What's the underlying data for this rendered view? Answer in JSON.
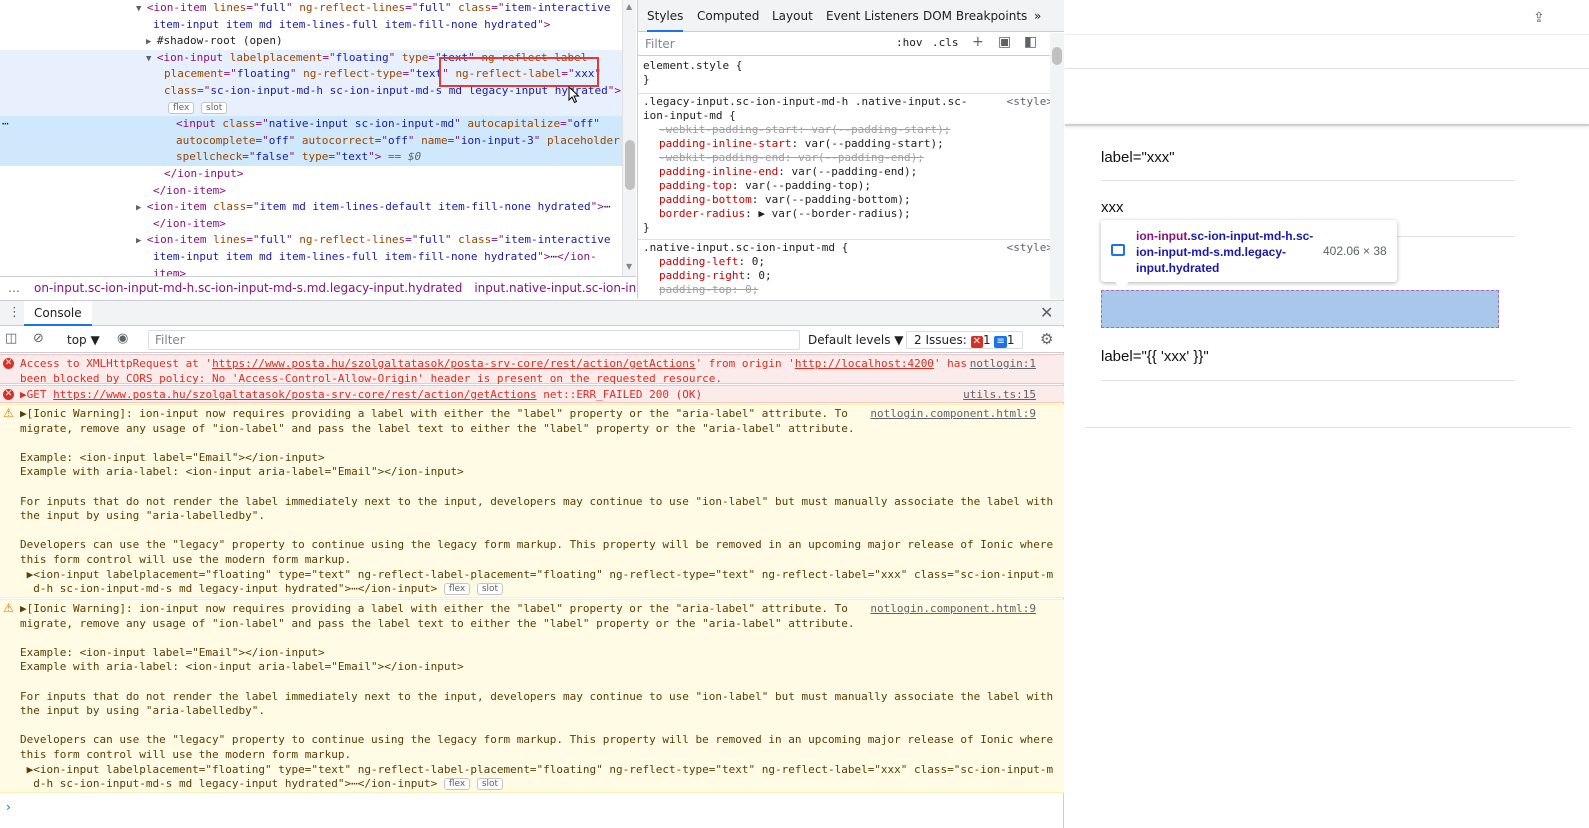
{
  "elements": {
    "lines": [
      {
        "indent": 146,
        "tri": "▼",
        "html": [
          [
            "tag",
            "<ion-item "
          ],
          [
            "attr",
            "lines"
          ],
          [
            "tag",
            "=\""
          ],
          [
            "val",
            "full"
          ],
          [
            "tag",
            "\" "
          ],
          [
            "attr",
            "ng-reflect-lines"
          ],
          [
            "tag",
            "=\""
          ],
          [
            "val",
            "full"
          ],
          [
            "tag",
            "\" "
          ],
          [
            "attr",
            "class"
          ],
          [
            "tag",
            "=\""
          ],
          [
            "val",
            "item-interactive"
          ]
        ]
      },
      {
        "indent": 153,
        "html": [
          [
            "val",
            "item-input item md item-lines-full item-fill-none hydrated"
          ],
          [
            "tag",
            "\">"
          ]
        ]
      },
      {
        "indent": 156,
        "tri": "▶",
        "html": [
          [
            "plain",
            "#shadow-root (open)"
          ]
        ]
      },
      {
        "indent": 156,
        "tri": "▼",
        "html": [
          [
            "tag",
            "<ion-input "
          ],
          [
            "attr",
            "labelplacement"
          ],
          [
            "tag",
            "=\""
          ],
          [
            "val",
            "floating"
          ],
          [
            "tag",
            "\" "
          ],
          [
            "attr",
            "type"
          ],
          [
            "tag",
            "=\""
          ],
          [
            "val",
            "text"
          ],
          [
            "tag",
            "\" "
          ],
          [
            "attr",
            "ng-reflect-label-"
          ]
        ],
        "hl": true
      },
      {
        "indent": 164,
        "html": [
          [
            "attr",
            "placement"
          ],
          [
            "tag",
            "=\""
          ],
          [
            "val",
            "floating"
          ],
          [
            "tag",
            "\" "
          ],
          [
            "attr",
            "ng-reflect-type"
          ],
          [
            "tag",
            "=\""
          ],
          [
            "val",
            "text"
          ],
          [
            "tag",
            "\" "
          ],
          [
            "attr",
            "ng-reflect-label"
          ],
          [
            "tag",
            "=\""
          ],
          [
            "val",
            "xxx"
          ],
          [
            "tag",
            "\""
          ]
        ],
        "hl": true
      },
      {
        "indent": 164,
        "html": [
          [
            "attr",
            "class"
          ],
          [
            "tag",
            "=\""
          ],
          [
            "val",
            "sc-ion-input-md-h sc-ion-input-md-s md legacy-input hydrated"
          ],
          [
            "tag",
            "\">"
          ]
        ],
        "hl": true
      },
      {
        "indent": 168,
        "badges": [
          "flex",
          "slot"
        ],
        "hl": true
      },
      {
        "indent": 176,
        "html": [
          [
            "tag",
            "<input "
          ],
          [
            "attr",
            "class"
          ],
          [
            "tag",
            "=\""
          ],
          [
            "val",
            "native-input sc-ion-input-md"
          ],
          [
            "tag",
            "\" "
          ],
          [
            "attr",
            "autocapitalize"
          ],
          [
            "tag",
            "=\""
          ],
          [
            "val",
            "off"
          ],
          [
            "tag",
            "\""
          ]
        ],
        "sel": true
      },
      {
        "indent": 176,
        "html": [
          [
            "attr",
            "autocomplete"
          ],
          [
            "tag",
            "=\""
          ],
          [
            "val",
            "off"
          ],
          [
            "tag",
            "\" "
          ],
          [
            "attr",
            "autocorrect"
          ],
          [
            "tag",
            "=\""
          ],
          [
            "val",
            "off"
          ],
          [
            "tag",
            "\" "
          ],
          [
            "attr",
            "name"
          ],
          [
            "tag",
            "=\""
          ],
          [
            "val",
            "ion-input-3"
          ],
          [
            "tag",
            "\" "
          ],
          [
            "attr",
            "placeholder"
          ]
        ],
        "sel": true
      },
      {
        "indent": 176,
        "html": [
          [
            "attr",
            "spellcheck"
          ],
          [
            "tag",
            "=\""
          ],
          [
            "val",
            "false"
          ],
          [
            "tag",
            "\" "
          ],
          [
            "attr",
            "type"
          ],
          [
            "tag",
            "=\""
          ],
          [
            "val",
            "text"
          ],
          [
            "tag",
            "\">"
          ],
          [
            "dollar",
            " == $0"
          ]
        ],
        "sel": true
      },
      {
        "indent": 164,
        "html": [
          [
            "tag",
            "</ion-input>"
          ]
        ]
      },
      {
        "indent": 153,
        "html": [
          [
            "tag",
            "</ion-item>"
          ]
        ]
      },
      {
        "indent": 146,
        "tri": "▶",
        "html": [
          [
            "tag",
            "<ion-item "
          ],
          [
            "attr",
            "class"
          ],
          [
            "tag",
            "=\""
          ],
          [
            "val",
            "item md item-lines-default item-fill-none hydrated"
          ],
          [
            "tag",
            "\">"
          ],
          [
            "plain",
            "⋯"
          ]
        ]
      },
      {
        "indent": 153,
        "html": [
          [
            "tag",
            "</ion-item>"
          ]
        ]
      },
      {
        "indent": 146,
        "tri": "▶",
        "html": [
          [
            "tag",
            "<ion-item "
          ],
          [
            "attr",
            "lines"
          ],
          [
            "tag",
            "=\""
          ],
          [
            "val",
            "full"
          ],
          [
            "tag",
            "\" "
          ],
          [
            "attr",
            "ng-reflect-lines"
          ],
          [
            "tag",
            "=\""
          ],
          [
            "val",
            "full"
          ],
          [
            "tag",
            "\" "
          ],
          [
            "attr",
            "class"
          ],
          [
            "tag",
            "=\""
          ],
          [
            "val",
            "item-interactive"
          ]
        ]
      },
      {
        "indent": 153,
        "html": [
          [
            "val",
            "item-input item md item-lines-full item-fill-none hydrated"
          ],
          [
            "tag",
            "\">"
          ],
          [
            "plain",
            "⋯"
          ],
          [
            "tag",
            "</ion-"
          ]
        ]
      },
      {
        "indent": 153,
        "html": [
          [
            "tag",
            "item>"
          ]
        ]
      }
    ],
    "ellipsis": "⋯",
    "selected_dots": "⋯"
  },
  "breadcrumbs": {
    "dots": "…",
    "items": [
      "on-input.sc-ion-input-md-h.sc-ion-input-md-s.md.legacy-input.hydrated",
      "input.native-input.sc-ion-input-md"
    ],
    "end": "…"
  },
  "styles": {
    "tabs": [
      "Styles",
      "Computed",
      "Layout",
      "Event Listeners",
      "DOM Breakpoints",
      "»"
    ],
    "filter_placeholder": "Filter",
    "hov": ":hov",
    ".cls": ".cls",
    "rules": [
      {
        "kind": "selector",
        "text": "element.style {",
        "src": ""
      },
      {
        "kind": "close",
        "text": "}"
      },
      {
        "kind": "selector",
        "text": ".legacy-input.sc-ion-input-md-h .native-input.sc-",
        "src": "<style>"
      },
      {
        "kind": "selector",
        "text": "ion-input-md {",
        "src": ""
      },
      {
        "kind": "decl",
        "prop": "-webkit-padding-start",
        "val": "var(--padding-start);",
        "strike": true
      },
      {
        "kind": "decl",
        "prop": "padding-inline-start",
        "val": "var(--padding-start);"
      },
      {
        "kind": "decl",
        "prop": "-webkit-padding-end",
        "val": "var(--padding-end);",
        "strike": true
      },
      {
        "kind": "decl",
        "prop": "padding-inline-end",
        "val": "var(--padding-end);"
      },
      {
        "kind": "decl",
        "prop": "padding-top",
        "val": "var(--padding-top);"
      },
      {
        "kind": "decl",
        "prop": "padding-bottom",
        "val": "var(--padding-bottom);"
      },
      {
        "kind": "decl",
        "prop": "border-radius",
        "val": "▶ var(--border-radius);"
      },
      {
        "kind": "close",
        "text": "}"
      },
      {
        "kind": "selector",
        "text": ".native-input.sc-ion-input-md {",
        "src": "<style>"
      },
      {
        "kind": "decl",
        "prop": "padding-left",
        "val": "0;"
      },
      {
        "kind": "decl",
        "prop": "padding-right",
        "val": "0;"
      },
      {
        "kind": "decl",
        "prop": "padding-top",
        "val": "0;",
        "strike": true
      }
    ]
  },
  "console": {
    "tab": "Console",
    "context": "top",
    "filter_placeholder": "Filter",
    "levels": "Default levels ▼",
    "issues_label": "2 Issues:",
    "issues_errors": "1",
    "issues_info": "1",
    "messages": [
      {
        "kind": "error",
        "height": 30,
        "lines": [
          [
            [
              "plain",
              "Access to XMLHttpRequest at '"
            ],
            [
              "link",
              "https://www.posta.hu/szolgaltatasok/posta-srv-core/rest/action/getActions"
            ],
            [
              "plain",
              "' from origin '"
            ],
            [
              "link",
              "http://localhost:4200"
            ],
            [
              "plain",
              "' has"
            ]
          ],
          [
            [
              "plain",
              "been blocked by CORS policy: No 'Access-Control-Allow-Origin' header is present on the requested resource."
            ]
          ]
        ],
        "src": "notlogin:1"
      },
      {
        "kind": "error",
        "height": 18,
        "lines": [
          [
            [
              "plain",
              "▶GET "
            ],
            [
              "link",
              "https://www.posta.hu/szolgaltatasok/posta-srv-core/rest/action/getActions"
            ],
            [
              "plain",
              " net::ERR_FAILED 200 (OK)"
            ]
          ]
        ],
        "src": "utils.ts:15"
      },
      {
        "kind": "warn",
        "height": 194,
        "lines": [
          [
            [
              "plain",
              "▶[Ionic Warning]: ion-input now requires providing a label with either the \"label\" property or the \"aria-label\" attribute. To"
            ]
          ],
          [
            [
              "plain",
              "migrate, remove any usage of \"ion-label\" and pass the label text to either the \"label\" property or the \"aria-label\" attribute."
            ]
          ],
          [
            [
              "plain",
              ""
            ]
          ],
          [
            [
              "plain",
              "Example: <ion-input label=\"Email\"></ion-input>"
            ]
          ],
          [
            [
              "plain",
              "Example with aria-label: <ion-input aria-label=\"Email\"></ion-input>"
            ]
          ],
          [
            [
              "plain",
              ""
            ]
          ],
          [
            [
              "plain",
              "For inputs that do not render the label immediately next to the input, developers may continue to use \"ion-label\" but must manually associate the label with"
            ]
          ],
          [
            [
              "plain",
              "the input by using \"aria-labelledby\"."
            ]
          ],
          [
            [
              "plain",
              ""
            ]
          ],
          [
            [
              "plain",
              "Developers can use the \"legacy\" property to continue using the legacy form markup. This property will be removed in an upcoming major release of Ionic where"
            ]
          ],
          [
            [
              "plain",
              "this form control will use the modern form markup."
            ]
          ],
          [
            [
              "plain",
              " ▶<ion-input labelplacement=\"floating\" type=\"text\" ng-reflect-label-placement=\"floating\" ng-reflect-type=\"text\" ng-reflect-label=\"xxx\" class=\"sc-ion-input-m"
            ]
          ],
          [
            [
              "plain",
              "  d-h sc-ion-input-md-s md legacy-input hydrated\">⋯</ion-input>"
            ]
          ]
        ],
        "src": "notlogin.component.html:9",
        "badges": [
          "flex",
          "slot"
        ]
      },
      {
        "kind": "warn",
        "height": 194,
        "lines": [
          [
            [
              "plain",
              "▶[Ionic Warning]: ion-input now requires providing a label with either the \"label\" property or the \"aria-label\" attribute. To"
            ]
          ],
          [
            [
              "plain",
              "migrate, remove any usage of \"ion-label\" and pass the label text to either the \"label\" property or the \"aria-label\" attribute."
            ]
          ],
          [
            [
              "plain",
              ""
            ]
          ],
          [
            [
              "plain",
              "Example: <ion-input label=\"Email\"></ion-input>"
            ]
          ],
          [
            [
              "plain",
              "Example with aria-label: <ion-input aria-label=\"Email\"></ion-input>"
            ]
          ],
          [
            [
              "plain",
              ""
            ]
          ],
          [
            [
              "plain",
              "For inputs that do not render the label immediately next to the input, developers may continue to use \"ion-label\" but must manually associate the label with"
            ]
          ],
          [
            [
              "plain",
              "the input by using \"aria-labelledby\"."
            ]
          ],
          [
            [
              "plain",
              ""
            ]
          ],
          [
            [
              "plain",
              "Developers can use the \"legacy\" property to continue using the legacy form markup. This property will be removed in an upcoming major release of Ionic where"
            ]
          ],
          [
            [
              "plain",
              "this form control will use the modern form markup."
            ]
          ],
          [
            [
              "plain",
              " ▶<ion-input labelplacement=\"floating\" type=\"text\" ng-reflect-label-placement=\"floating\" ng-reflect-type=\"text\" ng-reflect-label=\"xxx\" class=\"sc-ion-input-m"
            ]
          ],
          [
            [
              "plain",
              "  d-h sc-ion-input-md-s md legacy-input hydrated\">⋯</ion-input>"
            ]
          ]
        ],
        "src": "notlogin.component.html:9",
        "badges": [
          "flex",
          "slot"
        ]
      }
    ],
    "prompt": "›"
  },
  "page": {
    "field1": "label=\"xxx\"",
    "field2": "xxx",
    "field3": "label=\"{{ 'xxx' }}\"",
    "tooltip": {
      "tag": "ion-input",
      "classes": ".sc-ion-input-md-h.sc-ion-input-md-s.md.legacy-input.hydrated",
      "size": "402.06 × 38"
    }
  },
  "colors": {
    "accent": "#1a73e8",
    "error": "#d93025",
    "warn_bg": "#fffbe5",
    "highlight": "#a8c7ea"
  }
}
